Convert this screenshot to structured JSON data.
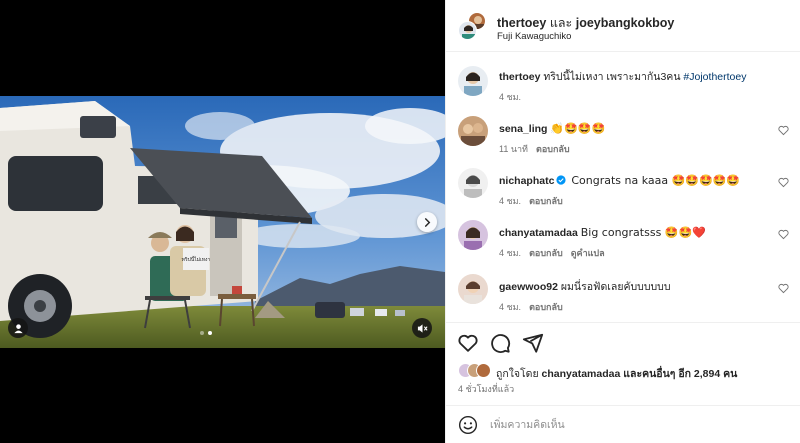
{
  "header": {
    "user1": "thertoey",
    "conjunction": "และ",
    "user2": "joeybangkokboy",
    "location": "Fuji Kawaguchiko"
  },
  "caption": {
    "user": "thertoey",
    "text": "ทริปนี้ไม่เหงา เพราะมากัน3คน",
    "hashtag": "#Jojothertoey",
    "time": "4 ชม."
  },
  "comments": [
    {
      "user": "sena_ling",
      "text": "👏🤩🤩🤩",
      "time": "11 นาที",
      "reply": "ตอบกลับ",
      "verified": false,
      "translate": ""
    },
    {
      "user": "nichaphatc",
      "text": "Congrats na kaaa 🤩🤩🤩🤩🤩",
      "time": "4 ชม.",
      "reply": "ตอบกลับ",
      "verified": true,
      "translate": ""
    },
    {
      "user": "chanyatamadaa",
      "text": "Big congratsss 🤩🤩❤️",
      "time": "4 ชม.",
      "reply": "ตอบกลับ",
      "verified": false,
      "translate": "ดูคำแปล"
    },
    {
      "user": "gaewwoo92",
      "text": "ผมนี่รอฟัดเลยคับบบบบบ",
      "time": "4 ชม.",
      "reply": "ตอบกลับ",
      "verified": false,
      "translate": ""
    }
  ],
  "likes": {
    "prefix": "ถูกใจโดย",
    "user": "chanyatamadaa",
    "and_others": "และคนอื่นๆ",
    "extra": "อีก 2,894 คน"
  },
  "post_time": "4 ชั่วโมงที่แล้ว",
  "add_comment": {
    "placeholder": "เพิ่มความคิดเห็น"
  },
  "carousel": {
    "total_slides": 2,
    "active_slide": 1
  },
  "photo": {
    "sign_text": "ทริปนี้ไม่เหงา"
  },
  "icons": {
    "like": "heart-icon",
    "comment": "comment-icon",
    "share": "share-icon",
    "next": "chevron-right-icon",
    "tag": "user-tag-icon",
    "mute": "muted-speaker-icon",
    "emoji": "emoji-icon",
    "verified": "verified-badge-icon"
  },
  "colors": {
    "accent_link": "#00376b",
    "verified": "#0095f6",
    "heart_red": "#ed4956",
    "meta_grey": "#737373"
  }
}
